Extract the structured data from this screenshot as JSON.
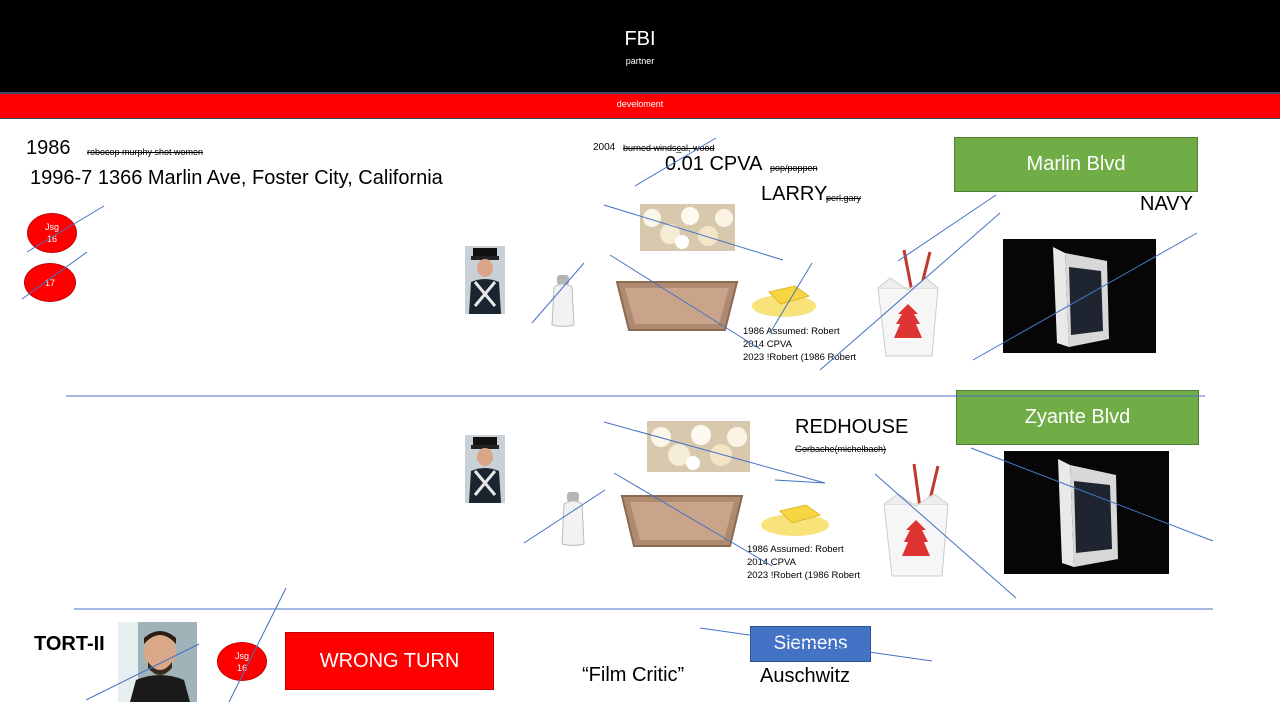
{
  "header": {
    "title": "FBI",
    "subtitle": "partner"
  },
  "banner": {
    "label": "develoment"
  },
  "top": {
    "year": "1986",
    "year_note": "robocop murphy shot women",
    "address": "1996-7 1366 Marlin Ave, Foster City, California",
    "year2004": "2004",
    "year2004_note": "burned windsc̲al, wood",
    "cpva": "0.01 CPVA",
    "cpva_note": "pop/poppen",
    "larry": "LARRY.",
    "larry_note": "perl.gary",
    "marlin": "Marlin Blvd",
    "navy": "NAVY",
    "notes": [
      "1986 Assumed: Robert",
      "2014 CPVA",
      "2023 !Robert (1986 Robert"
    ]
  },
  "badges": {
    "jsg16": [
      "Jsg",
      "16"
    ],
    "n17": "17",
    "jsg16b": [
      "Jsg",
      "16"
    ]
  },
  "middle": {
    "redhouse": "REDHOUSE",
    "redhouse_note": "Gorbache(michelbach)",
    "zyante": "Zyante Blvd",
    "notes": [
      "1986 Assumed: Robert",
      "2014 CPVA",
      "2023 !Robert (1986 Robert"
    ]
  },
  "bottom": {
    "tort": "TORT-II",
    "wrong_turn": "WRONG TURN",
    "film_critic": "“Film Critic”",
    "siemens": "Siemens",
    "auschwitz": "Auschwitz"
  },
  "icons": [
    "officer-photo",
    "salt-shaker-icon",
    "baking-pan-icon",
    "popcorn-photo",
    "butter-icon",
    "takeout-box-icon",
    "phone-photo",
    "man-photo"
  ],
  "colors": {
    "header": "#000000",
    "banner": "#ff0000",
    "green": "#70ad47",
    "blue": "#4472c4",
    "line": "#4472c4"
  }
}
